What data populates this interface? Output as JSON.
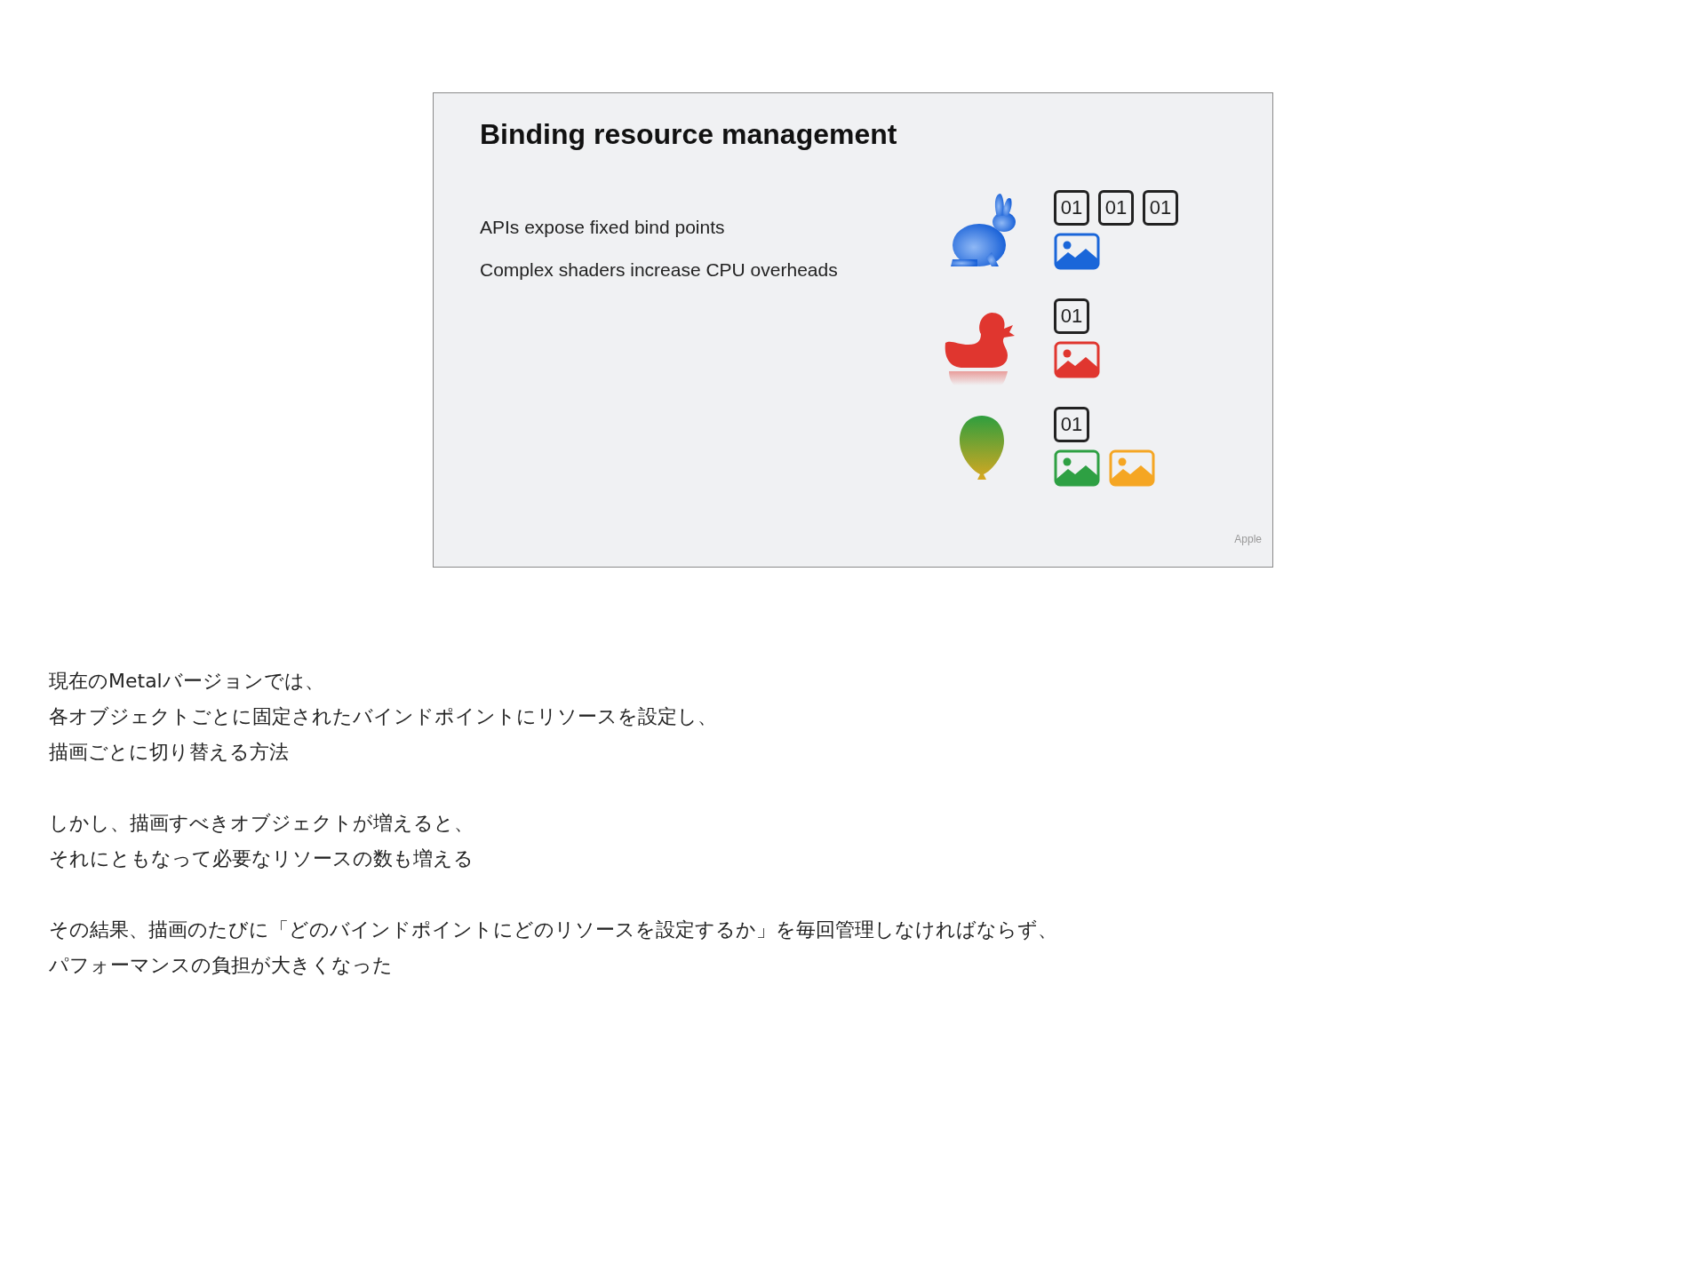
{
  "slide": {
    "title": "Binding resource management",
    "bullets": [
      "APIs expose fixed bind points",
      "Complex shaders increase CPU overheads"
    ],
    "objects": [
      {
        "kind": "rabbit",
        "buffers": [
          "01",
          "01",
          "01"
        ],
        "textures": [
          {
            "color": "#1a66d9"
          }
        ]
      },
      {
        "kind": "duck",
        "buffers": [
          "01"
        ],
        "textures": [
          {
            "color": "#e0362f"
          }
        ]
      },
      {
        "kind": "balloon",
        "buffers": [
          "01"
        ],
        "textures": [
          {
            "color": "#2ea043"
          },
          {
            "color": "#f5a623"
          }
        ]
      }
    ],
    "credit": "Apple"
  },
  "notes": [
    [
      "現在のMetalバージョンでは、",
      "各オブジェクトごとに固定されたバインドポイントにリソースを設定し、",
      "描画ごとに切り替える方法"
    ],
    [
      "しかし、描画すべきオブジェクトが増えると、",
      "それにともなって必要なリソースの数も増える"
    ],
    [
      "その結果、描画のたびに「どのバインドポイントにどのリソースを設定するか」を毎回管理しなければならず、",
      "パフォーマンスの負担が大きくなった"
    ]
  ]
}
